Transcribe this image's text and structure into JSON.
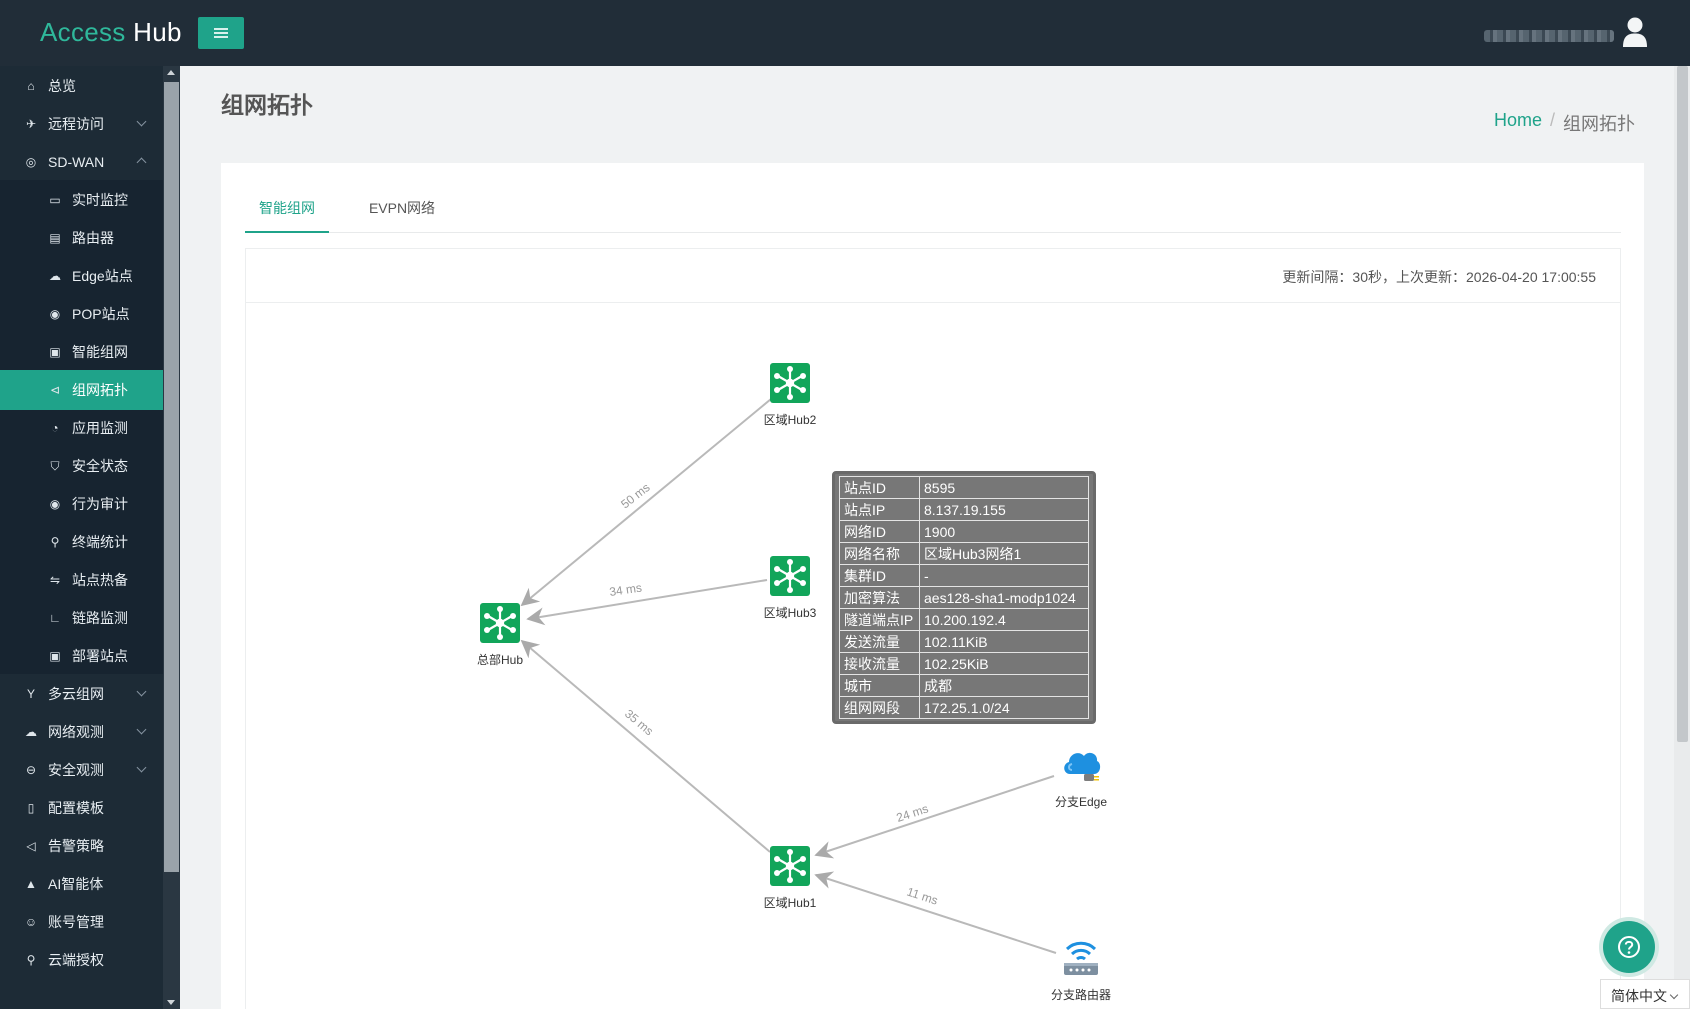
{
  "app": {
    "logo_a": "Access",
    "logo_b": " Hub"
  },
  "sidebar": {
    "items": [
      {
        "label": "总览",
        "icon": "home-icon",
        "name": "sidebar-item-overview"
      },
      {
        "label": "远程访问",
        "icon": "rocket-icon",
        "name": "sidebar-item-remote-access",
        "arrow": "down"
      },
      {
        "label": "SD-WAN",
        "icon": "globe-icon",
        "name": "sidebar-item-sdwan",
        "arrow": "up"
      },
      {
        "label": "实时监控",
        "icon": "monitor-icon",
        "name": "sidebar-item-realtime-monitor",
        "child": true
      },
      {
        "label": "路由器",
        "icon": "router-icon",
        "name": "sidebar-item-router",
        "child": true
      },
      {
        "label": "Edge站点",
        "icon": "cloud-icon",
        "name": "sidebar-item-edge-sites",
        "child": true
      },
      {
        "label": "POP站点",
        "icon": "location-icon",
        "name": "sidebar-item-pop-sites",
        "child": true
      },
      {
        "label": "智能组网",
        "icon": "lock-icon",
        "name": "sidebar-item-smart-network",
        "child": true
      },
      {
        "label": "组网拓扑",
        "icon": "share-icon",
        "name": "sidebar-item-topology",
        "child": true,
        "active": true
      },
      {
        "label": "应用监测",
        "icon": "pie-chart-icon",
        "name": "sidebar-item-app-monitor",
        "child": true
      },
      {
        "label": "安全状态",
        "icon": "shield-icon",
        "name": "sidebar-item-security-status",
        "child": true
      },
      {
        "label": "行为审计",
        "icon": "eye-icon",
        "name": "sidebar-item-behavior-audit",
        "child": true
      },
      {
        "label": "终端统计",
        "icon": "search-icon",
        "name": "sidebar-item-terminal-stats",
        "child": true
      },
      {
        "label": "站点热备",
        "icon": "swap-icon",
        "name": "sidebar-item-site-hot-standby",
        "child": true
      },
      {
        "label": "链路监测",
        "icon": "line-chart-icon",
        "name": "sidebar-item-link-monitor",
        "child": true
      },
      {
        "label": "部署站点",
        "icon": "deploy-icon",
        "name": "sidebar-item-deploy-sites",
        "child": true
      },
      {
        "label": "多云组网",
        "icon": "fork-icon",
        "name": "sidebar-item-multicloud",
        "arrow": "down"
      },
      {
        "label": "网络观测",
        "icon": "cloud-icon",
        "name": "sidebar-item-network-observe",
        "arrow": "down"
      },
      {
        "label": "安全观测",
        "icon": "minus-circle-icon",
        "name": "sidebar-item-security-observe",
        "arrow": "down"
      },
      {
        "label": "配置模板",
        "icon": "file-icon",
        "name": "sidebar-item-config-template"
      },
      {
        "label": "告警策略",
        "icon": "megaphone-icon",
        "name": "sidebar-item-alert-policy"
      },
      {
        "label": "AI智能体",
        "icon": "ai-icon",
        "name": "sidebar-item-ai-agent"
      },
      {
        "label": "账号管理",
        "icon": "users-icon",
        "name": "sidebar-item-account"
      },
      {
        "label": "云端授权",
        "icon": "key-icon",
        "name": "sidebar-item-cloud-license"
      }
    ]
  },
  "page": {
    "title": "组网拓扑"
  },
  "breadcrumb": {
    "home": "Home",
    "sep": "/",
    "current": "组网拓扑"
  },
  "tabs": [
    {
      "label": "智能组网",
      "active": true
    },
    {
      "label": "EVPN网络",
      "active": false
    }
  ],
  "update_info": "更新间隔：30秒，上次更新：2026-04-20 17:00:55",
  "topology": {
    "nodes": {
      "hq": "总部Hub",
      "hub2": "区域Hub2",
      "hub3": "区域Hub3",
      "hub1": "区域Hub1",
      "edge": "分支Edge",
      "router": "分支路由器"
    },
    "links": {
      "hub2_hq": "50 ms",
      "hub3_hq": "34 ms",
      "hub1_hq": "35 ms",
      "edge_hub1": "24 ms",
      "router_hub1": "11 ms"
    }
  },
  "tooltip": {
    "rows": [
      {
        "k": "站点ID",
        "v": "8595"
      },
      {
        "k": "站点IP",
        "v": "8.137.19.155"
      },
      {
        "k": "网络ID",
        "v": "1900"
      },
      {
        "k": "网络名称",
        "v": "区域Hub3网络1"
      },
      {
        "k": "集群ID",
        "v": "-"
      },
      {
        "k": "加密算法",
        "v": "aes128-sha1-modp1024"
      },
      {
        "k": "隧道端点IP",
        "v": "10.200.192.4"
      },
      {
        "k": "发送流量",
        "v": "102.11KiB"
      },
      {
        "k": "接收流量",
        "v": "102.25KiB"
      },
      {
        "k": "城市",
        "v": "成都"
      },
      {
        "k": "组网网段",
        "v": "172.25.1.0/24"
      }
    ]
  },
  "footer": {
    "language": "简体中文"
  },
  "colors": {
    "accent": "#1fa38a",
    "header": "#212d38",
    "sidebar": "#1d2b36"
  }
}
